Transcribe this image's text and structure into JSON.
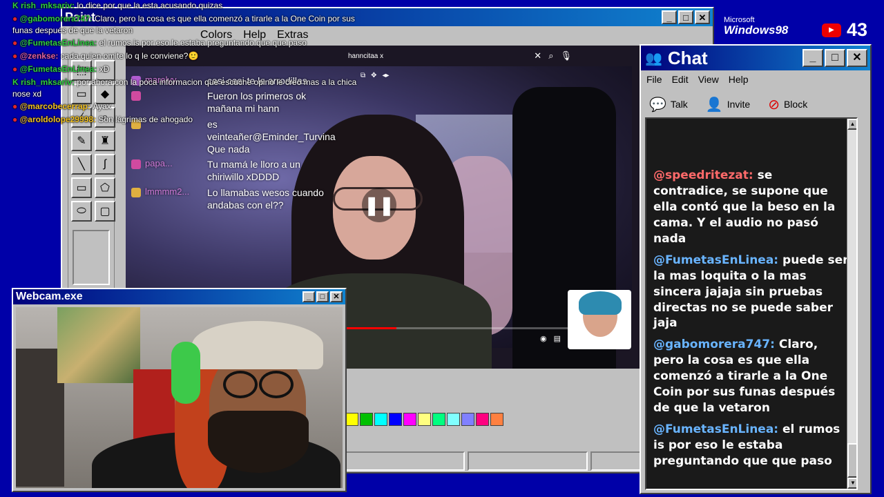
{
  "paint": {
    "title": "Paint",
    "menu": [
      "Colors",
      "Help",
      "Extras"
    ],
    "palette": [
      "#ffff00",
      "#00c000",
      "#00ffff",
      "#0000ff",
      "#ff00ff",
      "#ffff80",
      "#00ff80",
      "#80ffff",
      "#8080ff",
      "#ff0080",
      "#ff8040"
    ]
  },
  "video": {
    "search_text": "hanncitaa x",
    "chat": [
      {
        "user": "marelyy...",
        "message": "casi casi te le arrodillas"
      },
      {
        "user": "",
        "message": "Fueron los primeros ok mañana mi hann"
      },
      {
        "user": "",
        "message": "es veinteañer@Eminder_Turvina Que nada"
      },
      {
        "user": "papa...",
        "message": "Tu mamá le lloro a un chiriwillo xDDDD"
      },
      {
        "user": "lmmmm2...",
        "message": "Lo llamabas wesos cuando andabas con el??"
      }
    ],
    "progress": 0.18
  },
  "overlay_chat": [
    {
      "icon": "twitch-icon",
      "user": "rish_mksariv",
      "message": "lo dice por que la esta acusando quizas"
    },
    {
      "icon": "youtube-icon",
      "user": "@gabomorera747",
      "message": "Claro, pero la cosa es que ella comenzó a tirarle a la One Coin por sus funas después de que la vetaron"
    },
    {
      "icon": "youtube-icon",
      "user": "@FumetasEnLinea",
      "message": "el rumos is por eso le estaba preguntando que que paso"
    },
    {
      "icon": "youtube-icon",
      "user": "@zenkse",
      "message": "cada quien omite lo q le conviene?🙂"
    },
    {
      "icon": "youtube-icon",
      "user": "@FumetasEnLinea",
      "message": "xD"
    },
    {
      "icon": "twitch-icon",
      "user": "rish_mksariv",
      "message": "por ahora con la poca informacion que escuche opino le creo mas a la chica nose xd"
    },
    {
      "icon": "youtube-icon",
      "user": "@marcobecerrap",
      "message": "Ayax"
    },
    {
      "icon": "youtube-icon",
      "user": "@aroldolope29998",
      "message": "Son lágrimas de ahogado"
    }
  ],
  "webcam": {
    "title": "Webcam.exe"
  },
  "chat_window": {
    "title": "Chat",
    "menu": [
      "File",
      "Edit",
      "View",
      "Help"
    ],
    "tools": [
      {
        "icon": "talk-icon",
        "label": "Talk"
      },
      {
        "icon": "invite-icon",
        "label": "Invite"
      },
      {
        "icon": "block-icon",
        "label": "Block"
      }
    ],
    "messages": [
      {
        "user": "@speedritezat:",
        "message": "se contradice, se supone que ella contó que la beso en la cama. Y el audio no pasó nada"
      },
      {
        "user": "@FumetasEnLinea:",
        "message": "puede ser la mas loquita o la mas sincera jajaja sin pruebas directas no se puede saber jaja"
      },
      {
        "user": "@gabomorera747:",
        "message": "Claro, pero la cosa es que ella comenzó a tirarle a la One Coin por sus funas después de que la vetaron"
      },
      {
        "user": "@FumetasEnLinea:",
        "message": "el rumos is por eso le estaba preguntando que que paso"
      }
    ]
  },
  "branding": {
    "ms_line1": "Microsoft",
    "ms_line2": "Windows98",
    "viewer_count": "43"
  }
}
